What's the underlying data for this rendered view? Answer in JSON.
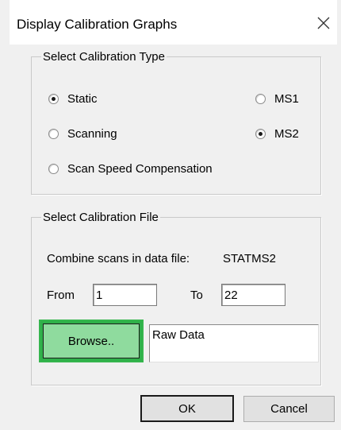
{
  "dialog": {
    "title": "Display Calibration Graphs",
    "close_icon": "close-icon"
  },
  "calibration_type": {
    "legend": "Select Calibration Type",
    "options": [
      {
        "label": "Static",
        "checked": true
      },
      {
        "label": "MS1",
        "checked": false
      },
      {
        "label": "Scanning",
        "checked": false
      },
      {
        "label": "MS2",
        "checked": true
      },
      {
        "label": "Scan Speed Compensation",
        "checked": false
      }
    ]
  },
  "calibration_file": {
    "legend": "Select Calibration File",
    "combine_label": "Combine scans in data file:",
    "file_name": "STATMS2",
    "from_label": "From",
    "from_value": "1",
    "to_label": "To",
    "to_value": "22",
    "browse_label": "Browse..",
    "raw_data": "Raw Data"
  },
  "buttons": {
    "ok": "OK",
    "cancel": "Cancel"
  },
  "colors": {
    "highlight": "#2fb04a",
    "browse_fill": "#8fdb9e",
    "client_bg": "#f0f0f0"
  }
}
